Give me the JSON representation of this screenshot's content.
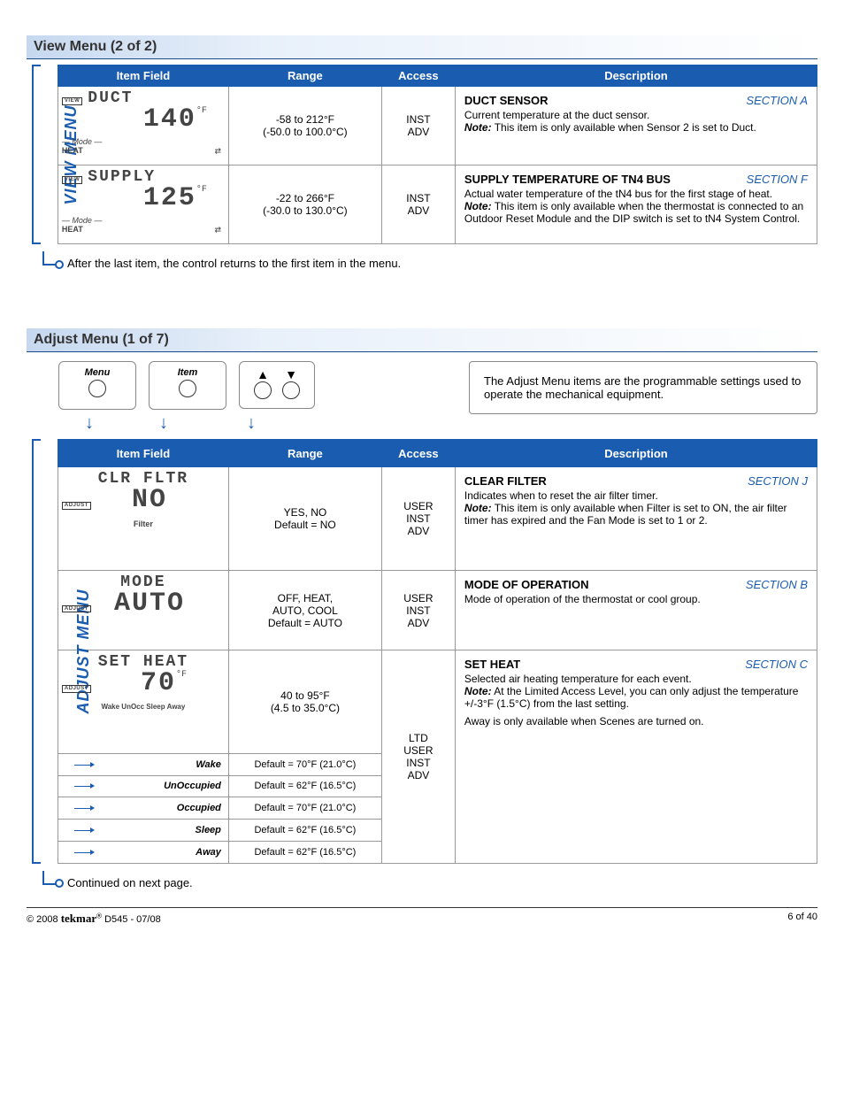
{
  "viewMenu": {
    "header": "View Menu (2 of 2)",
    "sideLabel": "VIEW MENU",
    "columns": {
      "item": "Item Field",
      "range": "Range",
      "access": "Access",
      "desc": "Description"
    },
    "rows": [
      {
        "lcd": {
          "badge": "VIEW",
          "line1": "DUCT",
          "big": "140",
          "unit": "°F",
          "mode": "— Mode —",
          "modeVal": "HEAT"
        },
        "rangeF": "-58 to 212°F",
        "rangeC": "(-50.0 to 100.0°C)",
        "access1": "INST",
        "access2": "ADV",
        "title": "DUCT SENSOR",
        "section": "SECTION A",
        "body": "Current temperature at the duct sensor.",
        "note": "This item is only available when Sensor 2 is set to Duct."
      },
      {
        "lcd": {
          "badge": "VIEW",
          "line1": "SUPPLY",
          "big": "125",
          "unit": "°F",
          "mode": "— Mode —",
          "modeVal": "HEAT"
        },
        "rangeF": "-22 to 266°F",
        "rangeC": "(-30.0 to 130.0°C)",
        "access1": "INST",
        "access2": "ADV",
        "title": "SUPPLY TEMPERATURE OF TN4 BUS",
        "section": "SECTION F",
        "body": "Actual water temperature of the tN4 bus for the first stage of heat.",
        "note": "This item is only available when the thermostat is connected to an Outdoor Reset Module and the DIP switch is set to tN4 System Control."
      }
    ],
    "afterNote": "After the last item, the control returns to the first item in the menu."
  },
  "adjustMenu": {
    "header": "Adjust Menu (1 of 7)",
    "sideLabel": "ADJUST MENU",
    "btnMenu": "Menu",
    "btnItem": "Item",
    "infoText": "The Adjust Menu items are the programmable settings used to operate the mechanical equipment.",
    "columns": {
      "item": "Item Field",
      "range": "Range",
      "access": "Access",
      "desc": "Description"
    },
    "rows": [
      {
        "lcd": {
          "line1": "CLR FLTR",
          "badge": "ADJUST",
          "big": "NO",
          "bottom": "Filter"
        },
        "range1": "YES, NO",
        "range2": "Default = NO",
        "access": "USER\nINST\nADV",
        "title": "CLEAR FILTER",
        "section": "SECTION J",
        "body": "Indicates when to reset the air filter timer.",
        "note": "This item is only available when Filter is set to ON, the air filter timer has expired and the Fan Mode is set to 1 or 2."
      },
      {
        "lcd": {
          "line1": "MODE",
          "badge": "ADJUST",
          "big": "AUTO"
        },
        "range1": "OFF, HEAT,\nAUTO, COOL",
        "range2": "Default = AUTO",
        "access": "USER\nINST\nADV",
        "title": "MODE OF OPERATION",
        "section": "SECTION B",
        "body": "Mode of operation of the thermostat or cool group."
      },
      {
        "lcd": {
          "line1": "SET HEAT",
          "badge": "ADJUST",
          "big": "70",
          "unit": "°F",
          "events": "Wake UnOcc Sleep Away"
        },
        "range1": "40 to 95°F",
        "range2": "(4.5 to 35.0°C)",
        "access": "LTD\nUSER\nINST\nADV",
        "title": "SET HEAT",
        "section": "SECTION C",
        "body": "Selected air heating temperature for each event.",
        "note": "At the Limited Access Level, you can only adjust the temperature +/-3°F (1.5°C) from the last setting.",
        "extra": "Away is only available when Scenes are turned on.",
        "sub": [
          {
            "label": "Wake",
            "def": "Default = 70°F (21.0°C)"
          },
          {
            "label": "UnOccupied",
            "def": "Default = 62°F (16.5°C)"
          },
          {
            "label": "Occupied",
            "def": "Default = 70°F (21.0°C)"
          },
          {
            "label": "Sleep",
            "def": "Default = 62°F (16.5°C)"
          },
          {
            "label": "Away",
            "def": "Default = 62°F (16.5°C)"
          }
        ]
      }
    ],
    "contNote": "Continued on next page."
  },
  "footer": {
    "copyright": "© 2008",
    "brand": "tekmar",
    "doc": "D545 - 07/08",
    "page": "6 of 40"
  }
}
